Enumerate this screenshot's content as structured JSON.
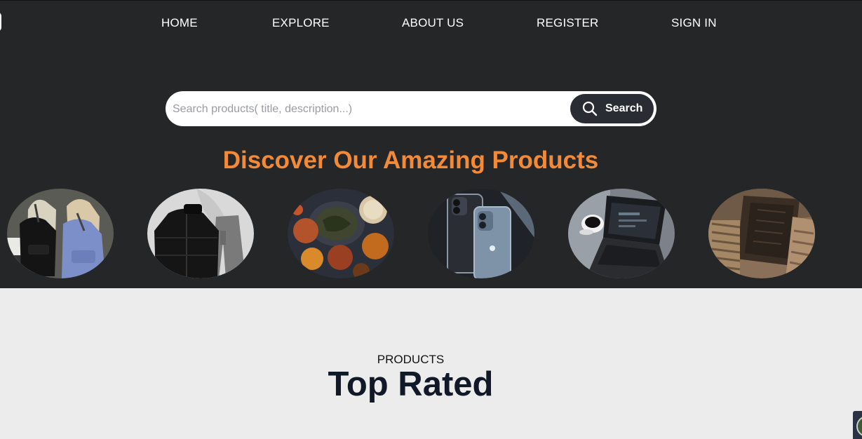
{
  "nav": {
    "items": [
      {
        "label": "HOME"
      },
      {
        "label": "EXPLORE"
      },
      {
        "label": "ABOUT US"
      },
      {
        "label": "REGISTER"
      },
      {
        "label": "SIGN IN"
      }
    ]
  },
  "search": {
    "placeholder": "Search products( title, description...)",
    "value": "",
    "button_label": "Search",
    "icon": "search-icon"
  },
  "hero": {
    "headline": "Discover Our Amazing Products"
  },
  "categories": [
    {
      "icon": "backpacks-image"
    },
    {
      "icon": "clothing-image"
    },
    {
      "icon": "food-image"
    },
    {
      "icon": "phones-image"
    },
    {
      "icon": "laptop-image"
    },
    {
      "icon": "books-image"
    }
  ],
  "products_section": {
    "label": "PRODUCTS",
    "title": "Top Rated"
  },
  "colors": {
    "hero_bg": "#252628",
    "page_bg": "#ececec",
    "accent": "#f28a38",
    "button_bg": "#2a2c33"
  }
}
